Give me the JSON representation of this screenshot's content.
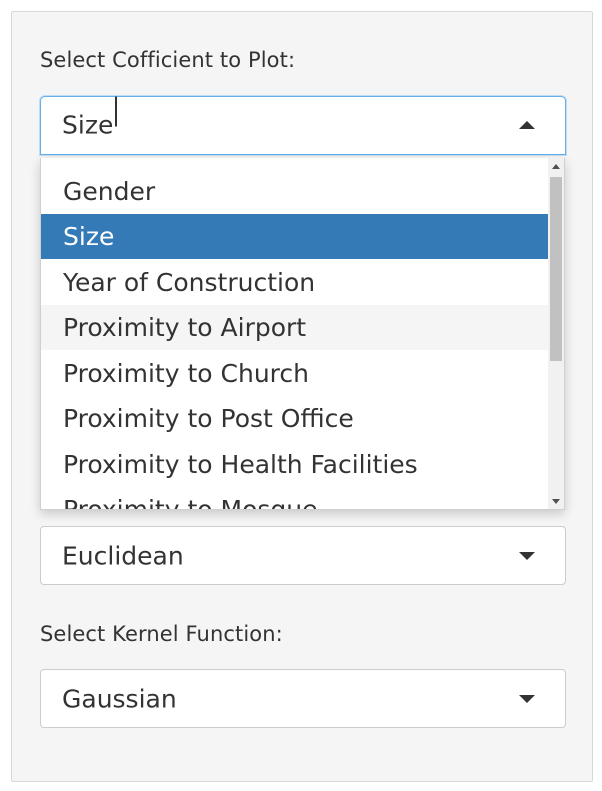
{
  "coefficient": {
    "label": "Select Cofficient to Plot:",
    "value": "Size",
    "options": [
      "Gender",
      "Size",
      "Year of Construction",
      "Proximity to Airport",
      "Proximity to Church",
      "Proximity to Post Office",
      "Proximity to Health Facilities",
      "Proximity to Mosque"
    ],
    "selected_index": 1,
    "hover_index": 3
  },
  "distance": {
    "value": "Euclidean"
  },
  "kernel": {
    "label": "Select Kernel Function:",
    "value": "Gaussian"
  },
  "colors": {
    "selected_bg": "#337ab7",
    "hover_bg": "#f5f5f5",
    "panel_bg": "#f5f5f5",
    "focus_border": "#66afe9"
  },
  "icons": {
    "open_arrow": "caret-up-icon",
    "closed_arrow": "caret-down-icon"
  }
}
